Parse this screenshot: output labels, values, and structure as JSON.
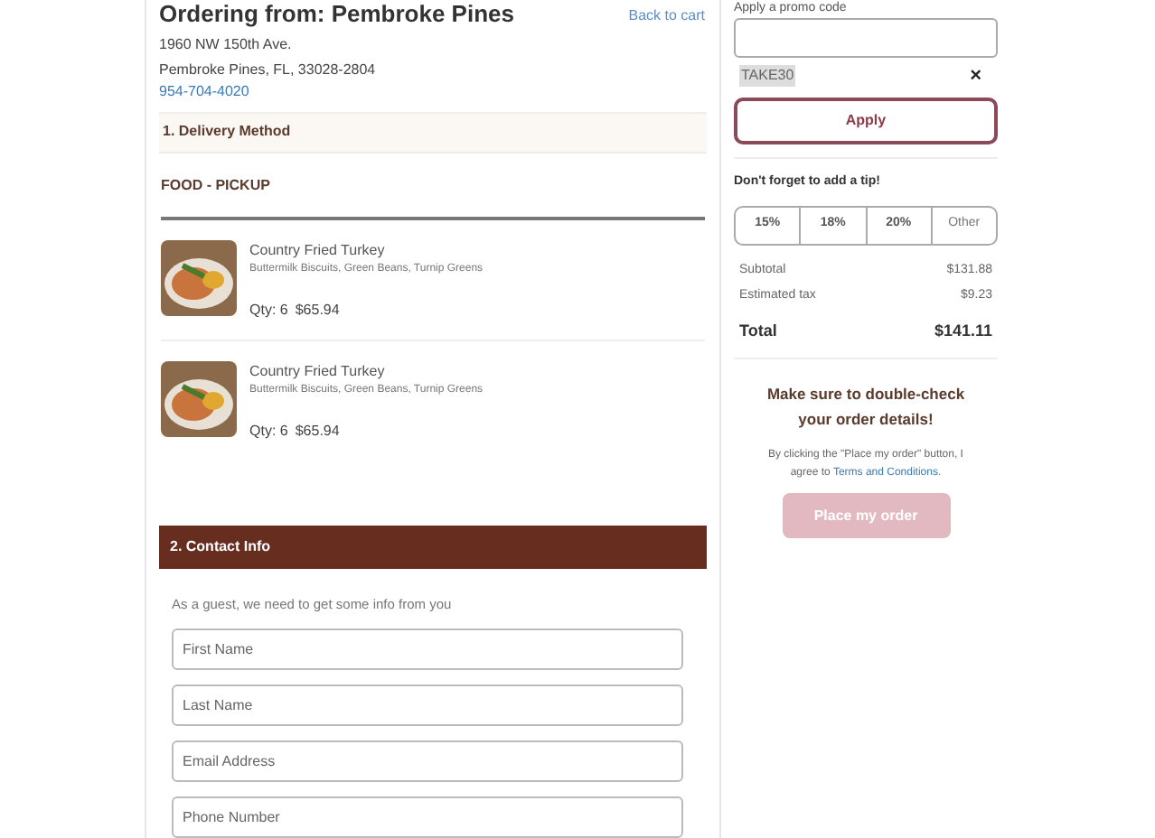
{
  "store": {
    "title": "Ordering from: Pembroke Pines",
    "address_line_1": "1960 NW 150th Ave.",
    "address_line_2": "Pembroke Pines, FL, 33028-2804",
    "phone": "954-704-4020",
    "back_link": "Back to cart"
  },
  "delivery": {
    "heading": "1. Delivery Method",
    "method": "FOOD - PICKUP",
    "items": [
      {
        "name": "Country Fried Turkey",
        "sides": "Buttermilk Biscuits, Green Beans, Turnip Greens",
        "qty": "Qty: 6",
        "price": "$65.94"
      },
      {
        "name": "Country Fried Turkey",
        "sides": "Buttermilk Biscuits, Green Beans, Turnip Greens",
        "qty": "Qty: 6",
        "price": "$65.94"
      }
    ]
  },
  "contact": {
    "heading": "2. Contact Info",
    "intro": "As a guest, we need to get some info from you",
    "fields": [
      {
        "placeholder": "First Name"
      },
      {
        "placeholder": "Last Name"
      },
      {
        "placeholder": "Email Address"
      },
      {
        "placeholder": "Phone Number"
      }
    ]
  },
  "promo": {
    "label": "Apply a promo code",
    "applied_code": "TAKE30",
    "remove": "×",
    "button": "Apply"
  },
  "tip": {
    "label": "Don't forget to add a tip!",
    "options": [
      {
        "label": "15%",
        "selected": false
      },
      {
        "label": "18%",
        "selected": false
      },
      {
        "label": "20%",
        "selected": false
      },
      {
        "label": "Other",
        "selected": false
      }
    ]
  },
  "totals": {
    "rows": [
      {
        "label": "Subtotal",
        "value": "$131.88"
      },
      {
        "label": "Estimated tax",
        "value": "$9.23"
      }
    ],
    "total_label": "Total",
    "total_value": "$141.11"
  },
  "confirm": {
    "heading": "Make sure to double-check your order details!",
    "terms_before": "By clicking the \"Place my order\" button, I agree to",
    "terms_link": "Terms and Conditions.",
    "button": "Place my order",
    "button_disabled": true
  }
}
